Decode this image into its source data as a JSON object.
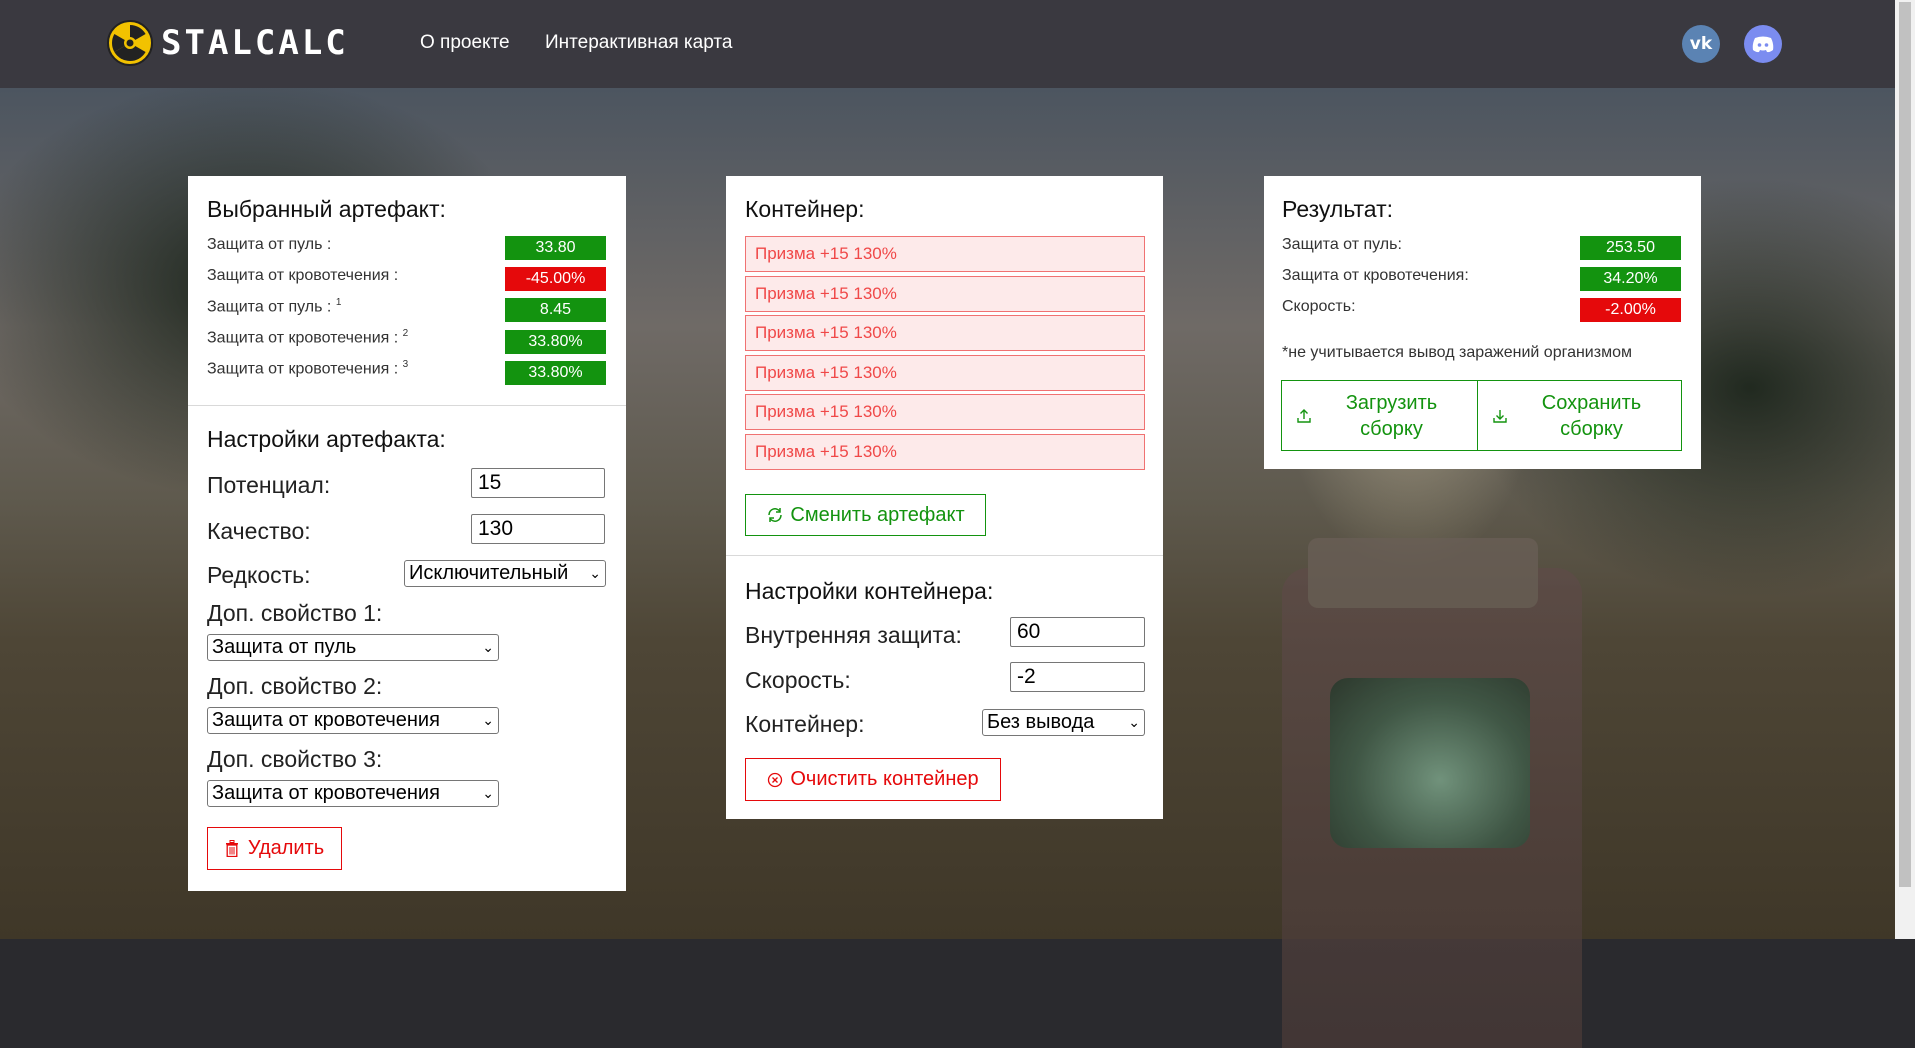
{
  "nav": {
    "brand": "STALCALC",
    "links": [
      "О проекте",
      "Интерактивная карта"
    ]
  },
  "artifact": {
    "title": "Выбранный артефакт:",
    "stats": [
      {
        "label": "Защита от пуль :",
        "sup": "",
        "value": "33.80",
        "color": "green"
      },
      {
        "label": "Защита от кровотечения :",
        "sup": "",
        "value": "-45.00%",
        "color": "red"
      },
      {
        "label": "Защита от пуль :",
        "sup": "1",
        "value": "8.45",
        "color": "green"
      },
      {
        "label": "Защита от кровотечения :",
        "sup": "2",
        "value": "33.80%",
        "color": "green"
      },
      {
        "label": "Защита от кровотечения :",
        "sup": "3",
        "value": "33.80%",
        "color": "green"
      }
    ],
    "settings_title": "Настройки артефакта:",
    "potential_label": "Потенциал:",
    "potential_value": "15",
    "quality_label": "Качество:",
    "quality_value": "130",
    "rarity_label": "Редкость:",
    "rarity_value": "Исключительный",
    "extra1_label": "Доп. свойство 1:",
    "extra1_value": "Защита от пуль",
    "extra2_label": "Доп. свойство 2:",
    "extra2_value": "Защита от кровотечения",
    "extra3_label": "Доп. свойство 3:",
    "extra3_value": "Защита от кровотечения",
    "delete_label": "Удалить"
  },
  "container": {
    "title": "Контейнер:",
    "slots": [
      "Призма +15 130%",
      "Призма +15 130%",
      "Призма +15 130%",
      "Призма +15 130%",
      "Призма +15 130%",
      "Призма +15 130%"
    ],
    "change_label": "Сменить артефакт",
    "settings_title": "Настройки контейнера:",
    "inner_label": "Внутренняя защита:",
    "inner_value": "60",
    "speed_label": "Скорость:",
    "speed_value": "-2",
    "type_label": "Контейнер:",
    "type_value": "Без вывода",
    "clear_label": "Очистить контейнер"
  },
  "result": {
    "title": "Результат:",
    "stats": [
      {
        "label": "Защита от пуль:",
        "value": "253.50",
        "color": "green"
      },
      {
        "label": "Защита от кровотечения:",
        "value": "34.20%",
        "color": "green"
      },
      {
        "label": "Скорость:",
        "value": "-2.00%",
        "color": "red"
      }
    ],
    "note": "*не учитывается вывод заражений организмом",
    "load_label": "Загрузить сборку",
    "save_label": "Сохранить сборку"
  },
  "colors": {
    "positive": "#13930f",
    "negative": "#e5090b",
    "navbar": "#3a3940"
  }
}
